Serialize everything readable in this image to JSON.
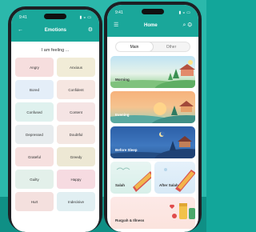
{
  "emotions_screen": {
    "status_time": "9:41",
    "title": "Emotions",
    "prompt": "I am feeling ...",
    "emotions": [
      {
        "label": "Angry",
        "color": "#f6dede"
      },
      {
        "label": "Anxious",
        "color": "#f1ecd7"
      },
      {
        "label": "Bored",
        "color": "#e4eef8"
      },
      {
        "label": "Confident",
        "color": "#f6e6e1"
      },
      {
        "label": "Confused",
        "color": "#dff1ee"
      },
      {
        "label": "Content",
        "color": "#f5e4e4"
      },
      {
        "label": "Depressed",
        "color": "#e7ecee"
      },
      {
        "label": "Doubtful",
        "color": "#f4e7e2"
      },
      {
        "label": "Grateful",
        "color": "#f6e0df"
      },
      {
        "label": "Greedy",
        "color": "#ede8d4"
      },
      {
        "label": "Guilty",
        "color": "#e3f0ea"
      },
      {
        "label": "Happy",
        "color": "#f6dbe1"
      },
      {
        "label": "Hurt",
        "color": "#f4e0de"
      },
      {
        "label": "Indecisive",
        "color": "#e1eff2"
      }
    ]
  },
  "home_screen": {
    "status_time": "9:41",
    "title": "Home",
    "tabs": [
      {
        "label": "Main",
        "active": true
      },
      {
        "label": "Other",
        "active": false
      }
    ],
    "cards": [
      {
        "label": "Morning"
      },
      {
        "label": "Evening"
      },
      {
        "label": "Before Sleep"
      }
    ],
    "split_cards": [
      {
        "label": "Salah"
      },
      {
        "label": "After Salah"
      }
    ],
    "last_card": {
      "label": "Ruqyah & Illness"
    }
  },
  "colors": {
    "brand": "#1aa79a",
    "background": "#2bb8ab"
  }
}
